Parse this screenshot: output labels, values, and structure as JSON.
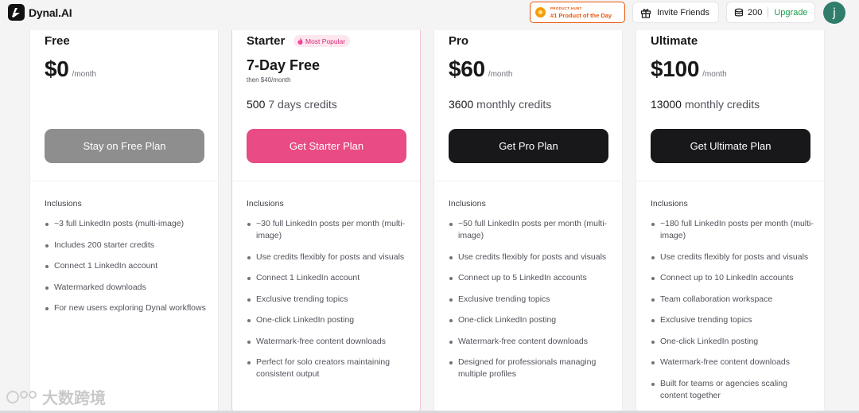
{
  "brand": {
    "name": "Dynal.AI"
  },
  "header": {
    "product_hunt_small": "PRODUCT HUNT",
    "product_hunt_big": "#1 Product of the Day",
    "invite_label": "Invite Friends",
    "credits": "200",
    "upgrade_label": "Upgrade",
    "avatar_initial": "j"
  },
  "plans": [
    {
      "name": "Free",
      "price": "$0",
      "per": "/month",
      "cta": "Stay on Free Plan",
      "inclusions_title": "Inclusions",
      "features": [
        "~3 full LinkedIn posts (multi-image)",
        "Includes 200 starter credits",
        "Connect 1 LinkedIn account",
        "Watermarked downloads",
        "For new users exploring Dynal workflows"
      ]
    },
    {
      "name": "Starter",
      "badge": "Most Popular",
      "trial": "7-Day Free",
      "trial_sub": "then $40/month",
      "credits_value": "500",
      "credits_unit": "7 days credits",
      "cta": "Get Starter Plan",
      "inclusions_title": "Inclusions",
      "features": [
        "~30 full LinkedIn posts per month (multi-image)",
        "Use credits flexibly for posts and visuals",
        "Connect 1 LinkedIn account",
        "Exclusive trending topics",
        "One-click LinkedIn posting",
        "Watermark-free content downloads",
        "Perfect for solo creators maintaining consistent output"
      ]
    },
    {
      "name": "Pro",
      "price": "$60",
      "per": "/month",
      "credits_value": "3600",
      "credits_unit": "monthly credits",
      "cta": "Get Pro Plan",
      "inclusions_title": "Inclusions",
      "features": [
        "~50 full LinkedIn posts per month (multi-image)",
        "Use credits flexibly for posts and visuals",
        "Connect up to 5 LinkedIn accounts",
        "Exclusive trending topics",
        "One-click LinkedIn posting",
        "Watermark-free content downloads",
        "Designed for professionals managing multiple profiles"
      ]
    },
    {
      "name": "Ultimate",
      "price": "$100",
      "per": "/month",
      "credits_value": "13000",
      "credits_unit": "monthly credits",
      "cta": "Get Ultimate Plan",
      "inclusions_title": "Inclusions",
      "features": [
        "~180 full LinkedIn posts per month (multi-image)",
        "Use credits flexibly for posts and visuals",
        "Connect up to 10 LinkedIn accounts",
        "Team collaboration workspace",
        "Exclusive trending topics",
        "One-click LinkedIn posting",
        "Watermark-free content downloads",
        "Built for teams or agencies scaling content together"
      ]
    }
  ],
  "watermark_text": "大数跨境",
  "colors": {
    "accent_pink": "#e94b84",
    "upgrade_green": "#16a34a",
    "avatar": "#2f7d6a"
  }
}
